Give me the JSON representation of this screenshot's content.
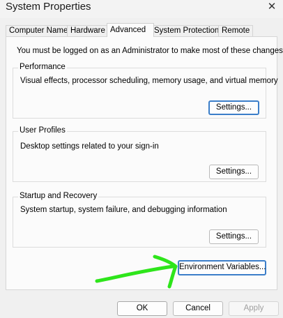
{
  "window": {
    "title": "System Properties",
    "close_glyph": "✕"
  },
  "tabs": [
    {
      "label": "Computer Name"
    },
    {
      "label": "Hardware"
    },
    {
      "label": "Advanced"
    },
    {
      "label": "System Protection"
    },
    {
      "label": "Remote"
    }
  ],
  "active_tab": "Advanced",
  "info_text": "You must be logged on as an Administrator to make most of these changes.",
  "groups": {
    "performance": {
      "title": "Performance",
      "description": "Visual effects, processor scheduling, memory usage, and virtual memory",
      "button": "Settings..."
    },
    "user_profiles": {
      "title": "User Profiles",
      "description": "Desktop settings related to your sign-in",
      "button": "Settings..."
    },
    "startup_recovery": {
      "title": "Startup and Recovery",
      "description": "System startup, system failure, and debugging information",
      "button": "Settings..."
    }
  },
  "environment_button": "Environment Variables...",
  "footer": {
    "ok": "OK",
    "cancel": "Cancel",
    "apply": "Apply"
  },
  "colors": {
    "focus_ring": "#3b7ec9",
    "annotation_arrow": "#2ee51b"
  }
}
